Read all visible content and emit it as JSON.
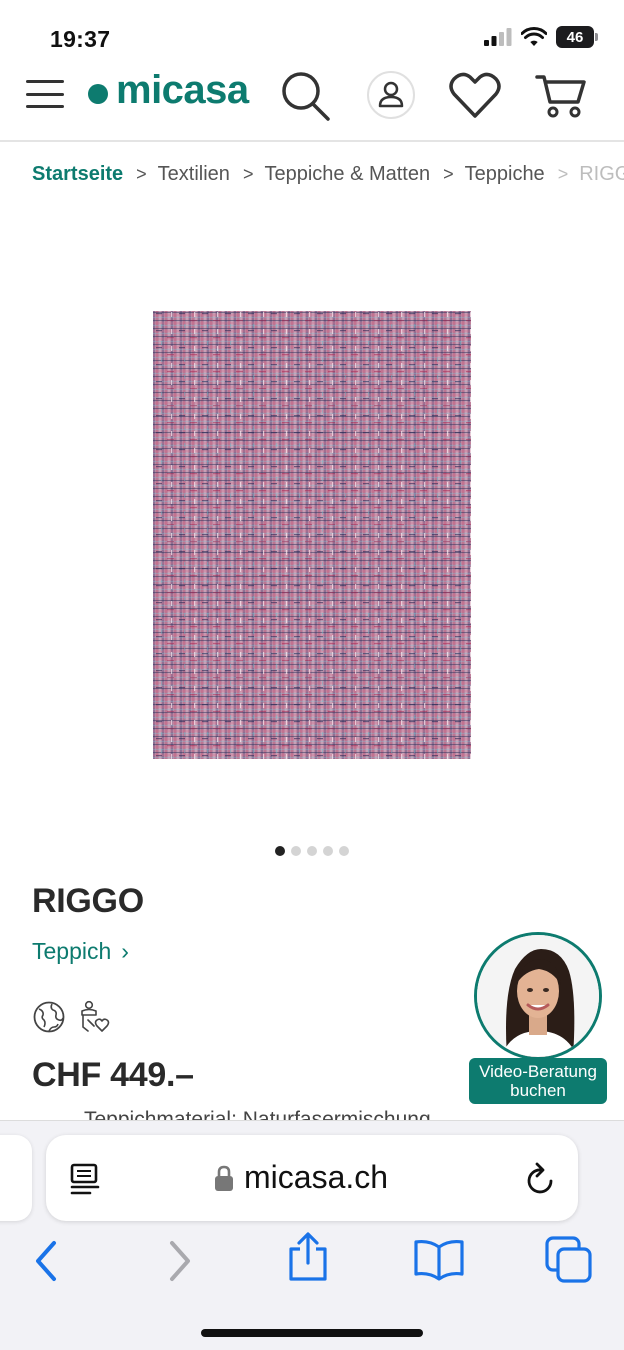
{
  "status_bar": {
    "time": "19:37",
    "battery": "46"
  },
  "header": {
    "logo_text": "micasa",
    "brand_color": "#0d7b6f",
    "icons": [
      "menu-icon",
      "search-icon",
      "account-icon",
      "wishlist-heart-icon",
      "cart-icon"
    ]
  },
  "breadcrumb": {
    "items": [
      "Startseite",
      "Textilien",
      "Teppiche & Matten",
      "Teppiche",
      "RIGG"
    ]
  },
  "gallery": {
    "dot_count": 5,
    "active_index": 0
  },
  "product": {
    "name": "RIGGO",
    "category": "Teppich",
    "category_chevron": "›",
    "price": "CHF 449.–",
    "description_partial": "Teppichmaterial: Naturfasermischung",
    "badge_icons": [
      "globe-icon",
      "fair-trade-hand-heart-icon"
    ]
  },
  "video_consult": {
    "label_line1": "Video-Beratung",
    "label_line2": "buchen"
  },
  "browser": {
    "url": "micasa.ch",
    "icons": [
      "reader-view-icon",
      "lock-icon",
      "reload-icon",
      "back-icon",
      "forward-icon",
      "share-icon",
      "bookmarks-icon",
      "tabs-icon"
    ],
    "accent": "#1a73e8"
  }
}
